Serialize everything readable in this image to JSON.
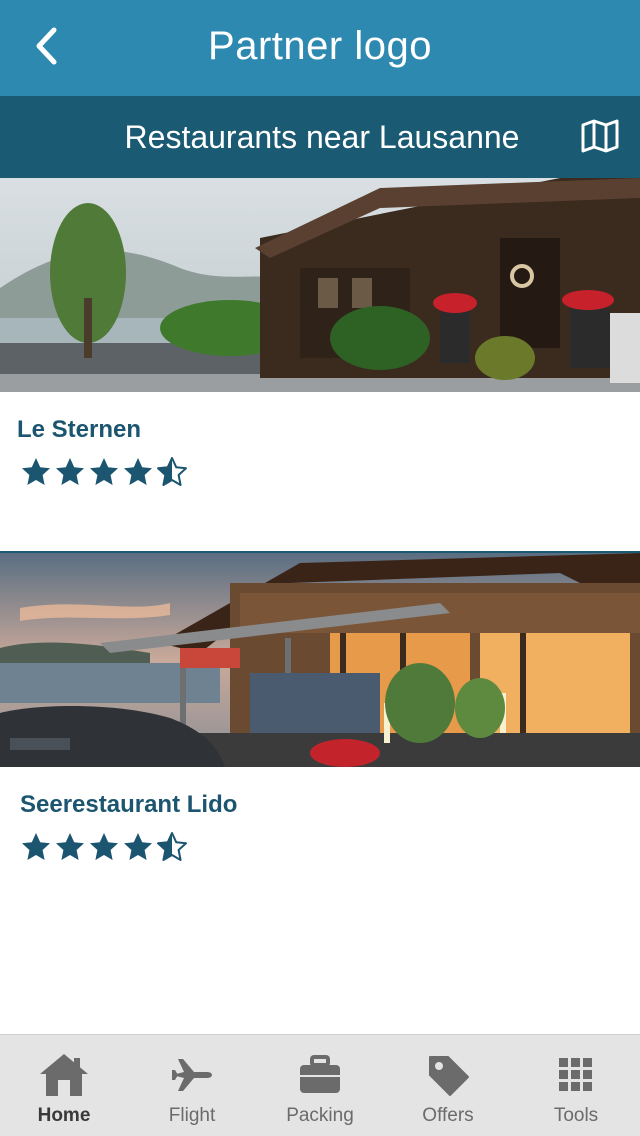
{
  "header": {
    "title": "Partner logo"
  },
  "subheader": {
    "title": "Restaurants near Lausanne"
  },
  "restaurants": [
    {
      "name": "Le Sternen",
      "rating": 4.5
    },
    {
      "name": "Seerestaurant Lido",
      "rating": 4.5
    }
  ],
  "tabs": [
    {
      "label": "Home",
      "icon": "home-icon",
      "active": true
    },
    {
      "label": "Flight",
      "icon": "airplane-icon",
      "active": false
    },
    {
      "label": "Packing",
      "icon": "suitcase-icon",
      "active": false
    },
    {
      "label": "Offers",
      "icon": "tag-icon",
      "active": false
    },
    {
      "label": "Tools",
      "icon": "grid-icon",
      "active": false
    }
  ],
  "colors": {
    "header": "#2e89b1",
    "subheader": "#1a5a73",
    "star": "#1c5570",
    "tab_icon": "#6b6b6b",
    "tab_background": "#e4e4e4"
  }
}
